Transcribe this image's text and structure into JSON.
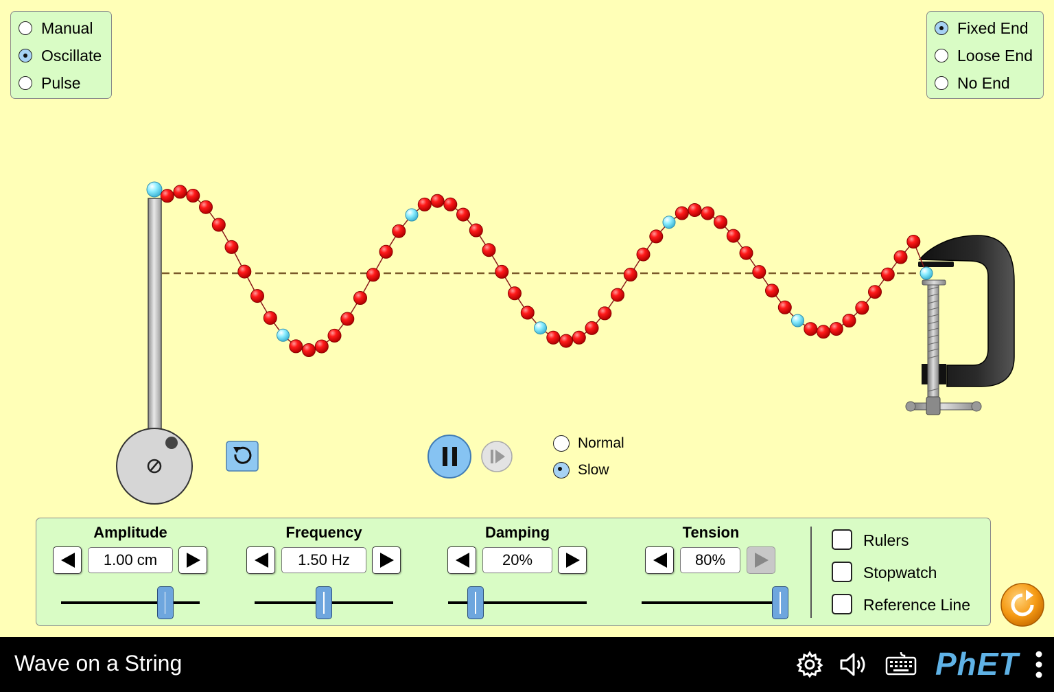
{
  "app": {
    "title": "Wave on a String",
    "logo": "PhET"
  },
  "mode": {
    "options": [
      "Manual",
      "Oscillate",
      "Pulse"
    ],
    "selected": "Oscillate"
  },
  "end": {
    "options": [
      "Fixed End",
      "Loose End",
      "No End"
    ],
    "selected": "Fixed End"
  },
  "speed": {
    "options": [
      "Normal",
      "Slow"
    ],
    "selected": "Slow"
  },
  "playback": {
    "state": "playing"
  },
  "controls": {
    "amplitude": {
      "label": "Amplitude",
      "value": "1.00 cm",
      "level": 0.75
    },
    "frequency": {
      "label": "Frequency",
      "value": "1.50 Hz",
      "level": 0.5
    },
    "damping": {
      "label": "Damping",
      "value": "20%",
      "level": 0.2
    },
    "tension": {
      "label": "Tension",
      "value": "80%",
      "level": 1.0
    }
  },
  "tools": {
    "rulers": "Rulers",
    "stopwatch": "Stopwatch",
    "reference_line": "Reference Line"
  },
  "colors": {
    "background": "#ffffb7",
    "panel": "#d9fcc5",
    "bead": "#ff0000",
    "bead_marker": "#7fe6ff",
    "navbar": "#000000",
    "logo": "#5fb2e6"
  },
  "icons": [
    "restart-icon",
    "pause-icon",
    "step-icon",
    "reset-all-icon",
    "settings-icon",
    "sound-icon",
    "keyboard-icon",
    "menu-icon"
  ]
}
